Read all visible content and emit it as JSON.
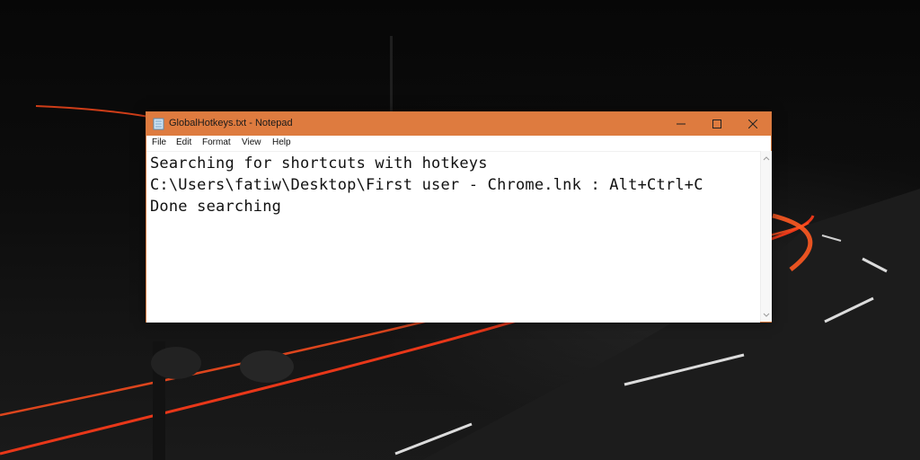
{
  "window": {
    "title": "GlobalHotkeys.txt - Notepad",
    "accent_color": "#de7b3f",
    "app_icon": "notepad-icon",
    "controls": {
      "minimize_icon": "minimize-icon",
      "maximize_icon": "maximize-icon",
      "close_icon": "close-icon"
    }
  },
  "menu": {
    "file": "File",
    "edit": "Edit",
    "format": "Format",
    "view": "View",
    "help": "Help"
  },
  "editor": {
    "lines": [
      "Searching for shortcuts with hotkeys",
      "C:\\Users\\fatiw\\Desktop\\First user - Chrome.lnk : Alt+Ctrl+C",
      "Done searching"
    ]
  },
  "scrollbar": {
    "up_icon": "scroll-up-arrow-icon",
    "down_icon": "scroll-down-arrow-icon"
  }
}
